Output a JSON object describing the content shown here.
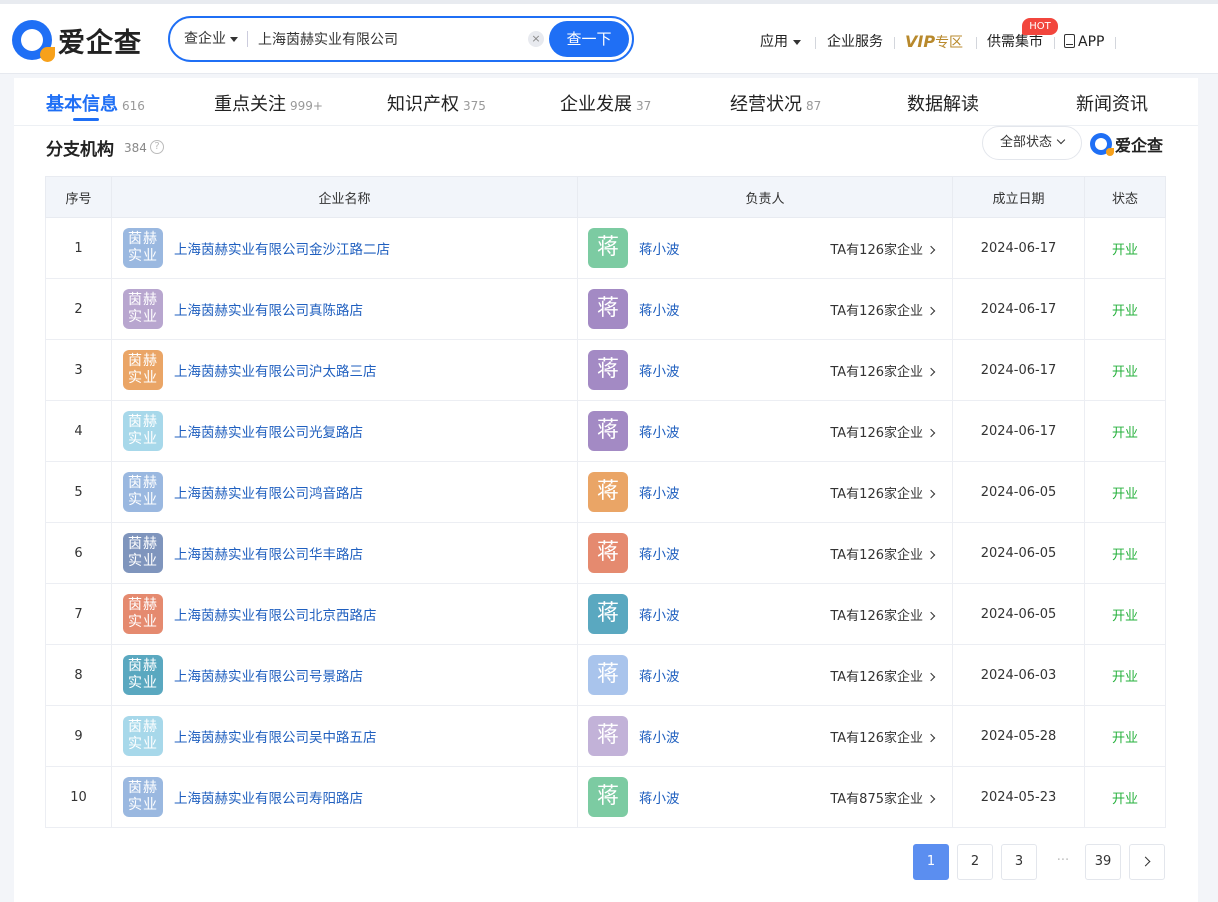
{
  "header": {
    "brand": "爱企查",
    "search": {
      "type_label": "查企业",
      "value": "上海茵赫实业有限公司",
      "clear_symbol": "×",
      "button_label": "查一下"
    },
    "nav": {
      "apps": "应用",
      "enterprise_service": "企业服务",
      "vip_prefix": "VIP",
      "vip_suffix": "专区",
      "supply_demand": "供需集市",
      "hot_badge": "HOT",
      "app": "APP"
    }
  },
  "tabs": [
    {
      "label": "基本信息",
      "count": "616"
    },
    {
      "label": "重点关注",
      "count": "999+"
    },
    {
      "label": "知识产权",
      "count": "375"
    },
    {
      "label": "企业发展",
      "count": "37"
    },
    {
      "label": "经营状况",
      "count": "87"
    },
    {
      "label": "数据解读",
      "count": ""
    },
    {
      "label": "新闻资讯",
      "count": ""
    }
  ],
  "section": {
    "title": "分支机构",
    "count": "384",
    "help_symbol": "?",
    "status_filter": "全部状态",
    "brand": "爱企查"
  },
  "table": {
    "headers": {
      "index": "序号",
      "name": "企业名称",
      "person": "负责人",
      "date": "成立日期",
      "status": "状态"
    },
    "rows": [
      {
        "index": "1",
        "logo_top": "茵赫",
        "logo_bottom": "实业",
        "logo_color": "#9ab8e0",
        "name": "上海茵赫实业有限公司金沙江路二店",
        "avatar": "蒋",
        "avatar_color": "#7ccba2",
        "person": "蒋小波",
        "ta": "TA有126家企业",
        "date": "2024-06-17",
        "status": "开业"
      },
      {
        "index": "2",
        "logo_top": "茵赫",
        "logo_bottom": "实业",
        "logo_color": "#b8a6cf",
        "name": "上海茵赫实业有限公司真陈路店",
        "avatar": "蒋",
        "avatar_color": "#a38ac4",
        "person": "蒋小波",
        "ta": "TA有126家企业",
        "date": "2024-06-17",
        "status": "开业"
      },
      {
        "index": "3",
        "logo_top": "茵赫",
        "logo_bottom": "实业",
        "logo_color": "#eaa566",
        "name": "上海茵赫实业有限公司沪太路三店",
        "avatar": "蒋",
        "avatar_color": "#a38ac4",
        "person": "蒋小波",
        "ta": "TA有126家企业",
        "date": "2024-06-17",
        "status": "开业"
      },
      {
        "index": "4",
        "logo_top": "茵赫",
        "logo_bottom": "实业",
        "logo_color": "#a7d8ea",
        "name": "上海茵赫实业有限公司光复路店",
        "avatar": "蒋",
        "avatar_color": "#a38ac4",
        "person": "蒋小波",
        "ta": "TA有126家企业",
        "date": "2024-06-17",
        "status": "开业"
      },
      {
        "index": "5",
        "logo_top": "茵赫",
        "logo_bottom": "实业",
        "logo_color": "#9ab8e0",
        "name": "上海茵赫实业有限公司鸿音路店",
        "avatar": "蒋",
        "avatar_color": "#eaa566",
        "person": "蒋小波",
        "ta": "TA有126家企业",
        "date": "2024-06-05",
        "status": "开业"
      },
      {
        "index": "6",
        "logo_top": "茵赫",
        "logo_bottom": "实业",
        "logo_color": "#7f95bd",
        "name": "上海茵赫实业有限公司华丰路店",
        "avatar": "蒋",
        "avatar_color": "#e58a6f",
        "person": "蒋小波",
        "ta": "TA有126家企业",
        "date": "2024-06-05",
        "status": "开业"
      },
      {
        "index": "7",
        "logo_top": "茵赫",
        "logo_bottom": "实业",
        "logo_color": "#e58a6f",
        "name": "上海茵赫实业有限公司北京西路店",
        "avatar": "蒋",
        "avatar_color": "#5aa8c0",
        "person": "蒋小波",
        "ta": "TA有126家企业",
        "date": "2024-06-05",
        "status": "开业"
      },
      {
        "index": "8",
        "logo_top": "茵赫",
        "logo_bottom": "实业",
        "logo_color": "#5aa8c0",
        "name": "上海茵赫实业有限公司号景路店",
        "avatar": "蒋",
        "avatar_color": "#a9c4ec",
        "person": "蒋小波",
        "ta": "TA有126家企业",
        "date": "2024-06-03",
        "status": "开业"
      },
      {
        "index": "9",
        "logo_top": "茵赫",
        "logo_bottom": "实业",
        "logo_color": "#a7d8ea",
        "name": "上海茵赫实业有限公司吴中路五店",
        "avatar": "蒋",
        "avatar_color": "#c2b2d8",
        "person": "蒋小波",
        "ta": "TA有126家企业",
        "date": "2024-05-28",
        "status": "开业"
      },
      {
        "index": "10",
        "logo_top": "茵赫",
        "logo_bottom": "实业",
        "logo_color": "#9ab8e0",
        "name": "上海茵赫实业有限公司寿阳路店",
        "avatar": "蒋",
        "avatar_color": "#7ccba2",
        "person": "蒋小波",
        "ta": "TA有875家企业",
        "date": "2024-05-23",
        "status": "开业"
      }
    ]
  },
  "pagination": {
    "current": "1",
    "second": "2",
    "third": "3",
    "ellipsis": "···",
    "last": "39"
  },
  "colors": {
    "primary": "#1f6ff5",
    "link": "#1f5fbf",
    "status_open": "#26b13c",
    "hot": "#f2463d",
    "vip": "#b8892c"
  }
}
